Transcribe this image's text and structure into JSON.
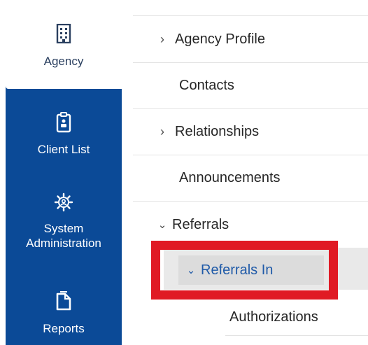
{
  "rail": {
    "items": [
      {
        "label": "Agency",
        "icon": "building-icon",
        "active": true
      },
      {
        "label": "Client List",
        "icon": "clipboard-icon",
        "active": false
      },
      {
        "label": "System Administration",
        "icon": "gear-icon",
        "active": false
      },
      {
        "label": "Reports",
        "icon": "document-icon",
        "active": false
      }
    ]
  },
  "nav": {
    "items": [
      {
        "label": "Agency Profile",
        "chevron": "right"
      },
      {
        "label": "Contacts",
        "chevron": "none"
      },
      {
        "label": "Relationships",
        "chevron": "right"
      },
      {
        "label": "Announcements",
        "chevron": "none"
      },
      {
        "label": "Referrals",
        "chevron": "down"
      }
    ],
    "referrals_sub": {
      "selected": {
        "label": "Referrals In",
        "chevron": "down"
      },
      "children": [
        {
          "label": "Authorizations"
        }
      ]
    }
  },
  "colors": {
    "rail_bg": "#0b4a97",
    "highlight": "#e01a24",
    "selected_text": "#1f5aa8"
  }
}
